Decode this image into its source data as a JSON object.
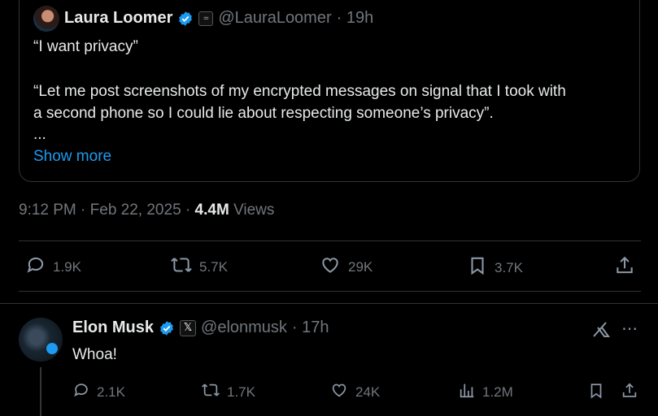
{
  "quoted_tweet": {
    "author_name": "Laura Loomer",
    "affiliation_badge": "=",
    "handle": "@LauraLoomer",
    "time": "· 19h",
    "lines": [
      "“I want privacy”",
      "“Let me post screenshots of my encrypted messages on signal that I took with",
      "a second phone so I could lie about respecting someone’s privacy”.",
      "..."
    ],
    "show_more": "Show more"
  },
  "tweet_meta": {
    "time": "9:12 PM",
    "sep1": "·",
    "date": "Feb 22, 2025",
    "sep2": "·",
    "views_count": "4.4M",
    "views_label": "Views"
  },
  "main_actions": {
    "replies": "1.9K",
    "reposts": "5.7K",
    "likes": "29K",
    "bookmarks": "3.7K"
  },
  "reply": {
    "author_name": "Elon Musk",
    "affiliation_badge": "𝕏",
    "handle": "@elonmusk",
    "time": "· 17h",
    "text": "Whoa!",
    "actions": {
      "replies": "2.1K",
      "reposts": "1.7K",
      "likes": "24K",
      "views": "1.2M"
    }
  },
  "colors": {
    "background": "#000000",
    "text": "#e7e9ea",
    "muted": "#71767b",
    "accent": "#1d9bf0",
    "border": "#2f3336"
  }
}
